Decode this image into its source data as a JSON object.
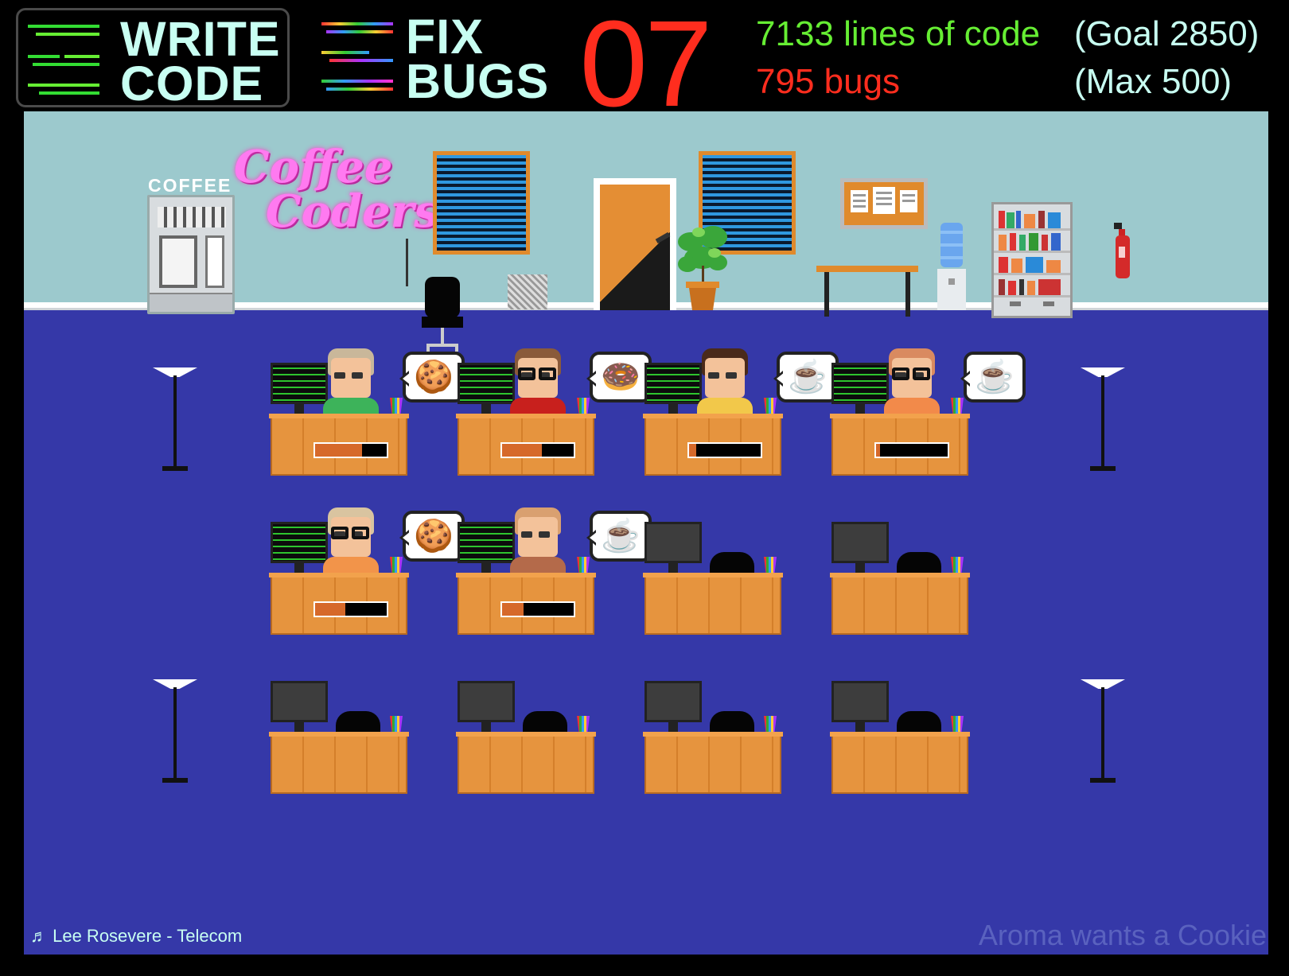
{
  "hud": {
    "write_code": {
      "line1": "WRITE",
      "line2": "CODE",
      "icon": "green-code-lines-icon"
    },
    "fix_bugs": {
      "line1": "FIX",
      "line2": "BUGS",
      "icon": "rainbow-code-lines-icon"
    },
    "timer": "07",
    "lines_of_code": "7133 lines of code",
    "goal": "(Goal 2850)",
    "bugs": "795 bugs",
    "max": "(Max 500)",
    "colors": {
      "code_green": "#66ee33",
      "bug_red": "#ff2d1e",
      "text_mint": "#c8fff2"
    }
  },
  "office": {
    "coffee_machine_label": "COFFEE",
    "neon_sign": {
      "line1": "Coffee",
      "line2": "Coders"
    },
    "colors": {
      "wall": "#9cc9cd",
      "floor": "#3538a8",
      "desk": "#e6943e",
      "progress": "#d6692a"
    }
  },
  "desks": [
    {
      "row": 1,
      "col": 1,
      "occupied": true,
      "progress": 0.65,
      "wants": "cookie-icon",
      "symbol": "🍪",
      "hair": "#c9b79a",
      "shirt": "#3db35a",
      "glasses": false
    },
    {
      "row": 1,
      "col": 2,
      "occupied": true,
      "progress": 0.55,
      "wants": "donut-icon",
      "symbol": "🍩",
      "hair": "#8a5a3a",
      "shirt": "#c8201d",
      "glasses": true
    },
    {
      "row": 1,
      "col": 3,
      "occupied": true,
      "progress": 0.1,
      "wants": "coffee-cup-icon",
      "symbol": "☕",
      "hair": "#4a2a1a",
      "shirt": "#f2c84a",
      "glasses": false
    },
    {
      "row": 1,
      "col": 4,
      "occupied": true,
      "progress": 0.05,
      "wants": "coffee-cup-icon",
      "symbol": "☕",
      "hair": "#d98a60",
      "shirt": "#f28a4a",
      "glasses": true
    },
    {
      "row": 2,
      "col": 1,
      "occupied": true,
      "progress": 0.42,
      "wants": "cookie-icon",
      "symbol": "🍪",
      "hair": "#d9c4a0",
      "shirt": "#f2944a",
      "glasses": true
    },
    {
      "row": 2,
      "col": 2,
      "occupied": true,
      "progress": 0.3,
      "wants": "coffee-cup-icon",
      "symbol": "☕",
      "hair": "#d9a070",
      "shirt": "#b46a4a",
      "glasses": false
    },
    {
      "row": 2,
      "col": 3,
      "occupied": false
    },
    {
      "row": 2,
      "col": 4,
      "occupied": false
    },
    {
      "row": 3,
      "col": 1,
      "occupied": false
    },
    {
      "row": 3,
      "col": 2,
      "occupied": false
    },
    {
      "row": 3,
      "col": 3,
      "occupied": false
    },
    {
      "row": 3,
      "col": 4,
      "occupied": false
    }
  ],
  "footer": {
    "music_icon": "music-note-icon",
    "music": "♬ Lee Rosevere - Telecom",
    "status": "Aroma wants a Cookie"
  }
}
